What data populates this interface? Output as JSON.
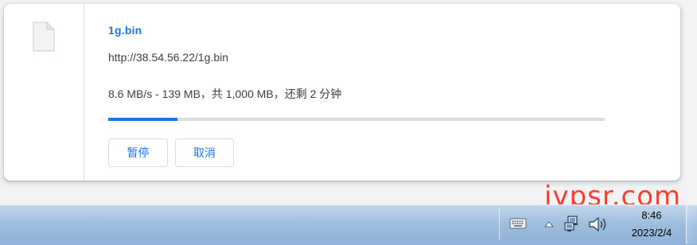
{
  "download": {
    "file_name": "1g.bin",
    "url": "http://38.54.56.22/1g.bin",
    "status": "8.6 MB/s - 139 MB，共 1,000 MB，还剩 2 分钟",
    "progress_percent": 13.9,
    "pause_label": "暂停",
    "cancel_label": "取消"
  },
  "taskbar": {
    "time": "8:46",
    "date": "2023/2/4",
    "icons": [
      "keyboard-icon",
      "show-hidden-icons-chevron-icon",
      "network-icon",
      "volume-icon"
    ]
  },
  "watermark": "ivpsr.com",
  "colors": {
    "accent": "#1a73e8",
    "text": "#3c4043",
    "track": "#dadce0",
    "watermark": "#ff2a1a"
  }
}
